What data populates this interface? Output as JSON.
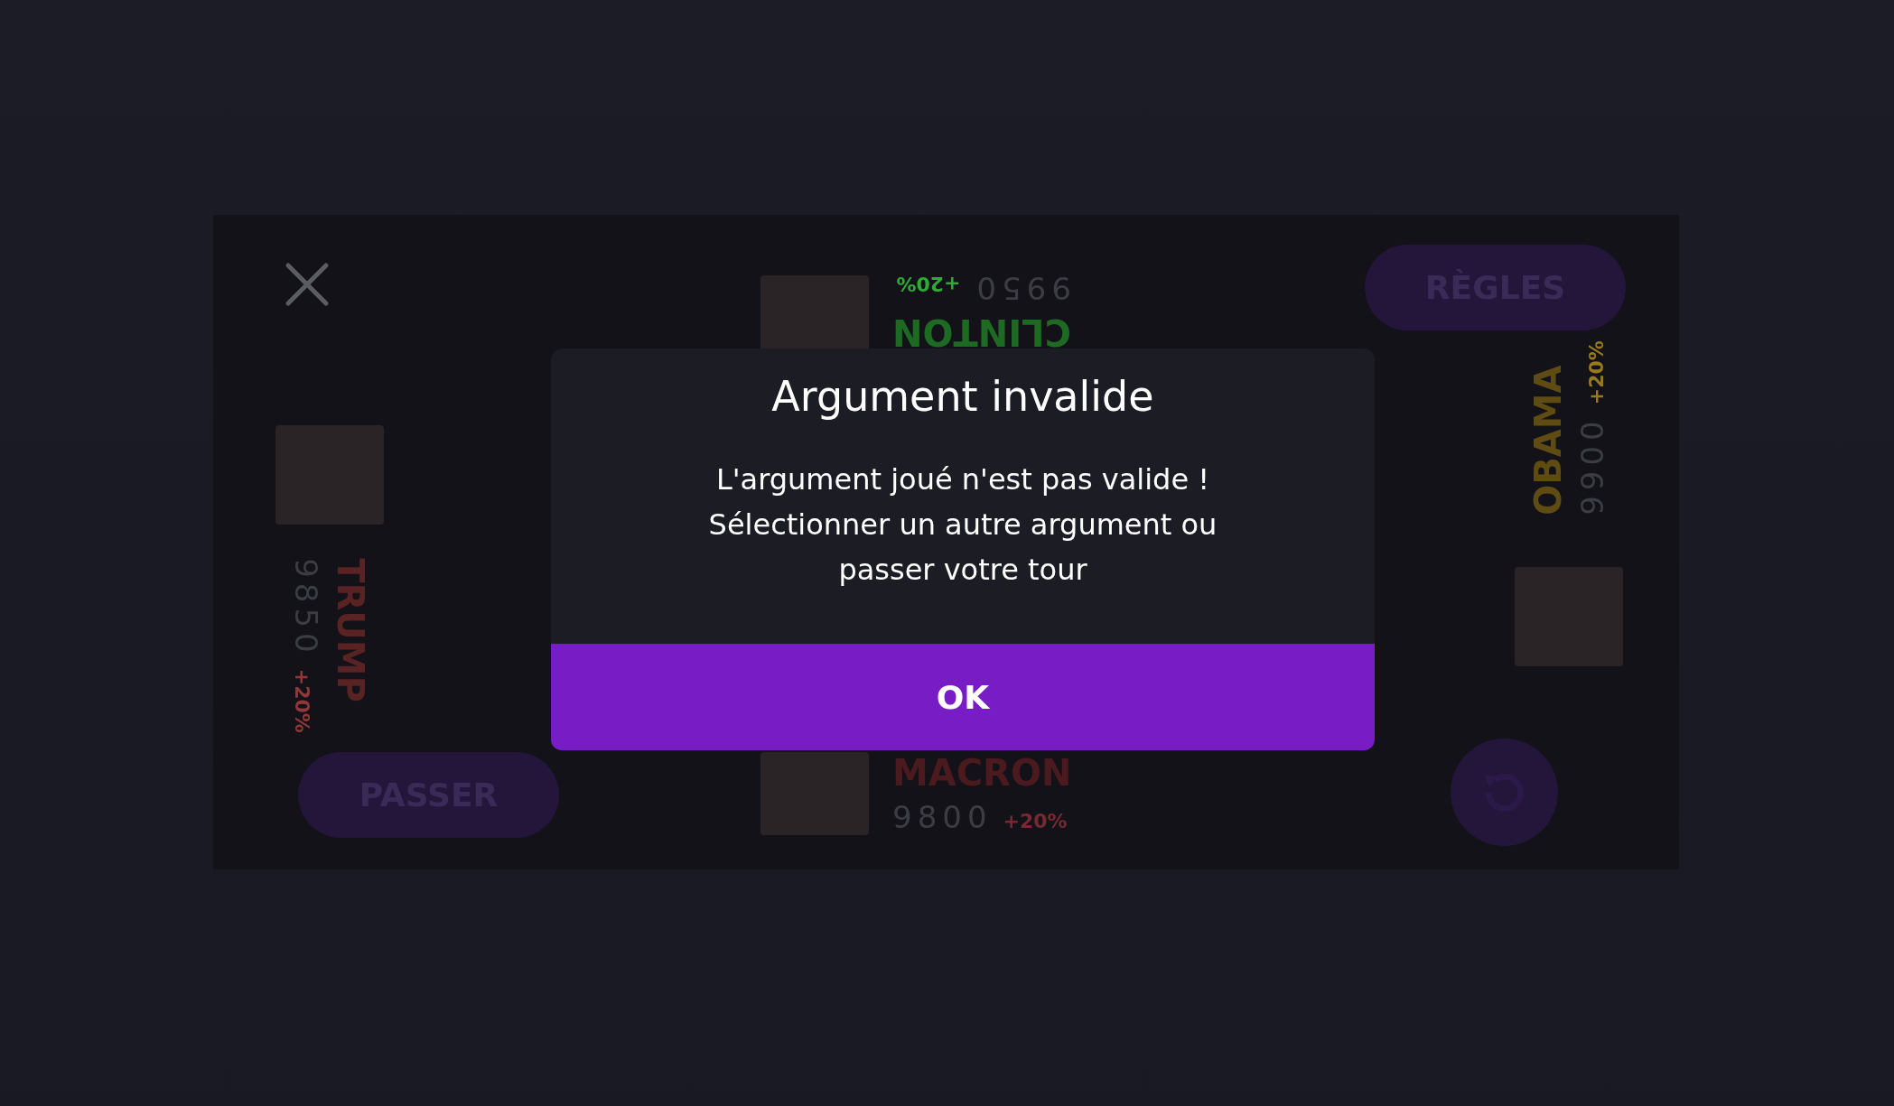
{
  "rules_button": {
    "label": "RÈGLES"
  },
  "pass_button": {
    "label": "PASSER"
  },
  "players": [
    {
      "kind": "top",
      "name": "CLINTON",
      "score": "9950",
      "bonus": "+20%",
      "color": "#1d6a22"
    },
    {
      "kind": "left",
      "name": "TRUMP",
      "score": "9850",
      "bonus": "+20%",
      "color": "#5a2323"
    },
    {
      "kind": "right",
      "name": "OBAMA",
      "score": "9900",
      "bonus": "+20%",
      "color": "#5e4c12"
    },
    {
      "kind": "bottom",
      "name": "MACRON",
      "score": "9800",
      "bonus": "+20%",
      "color": "#4a1a1e"
    }
  ],
  "dialog": {
    "title": "Argument invalide",
    "message": "L'argument joué n'est pas valide ! Sélectionner un autre argument ou passer votre tour",
    "ok": "OK"
  }
}
